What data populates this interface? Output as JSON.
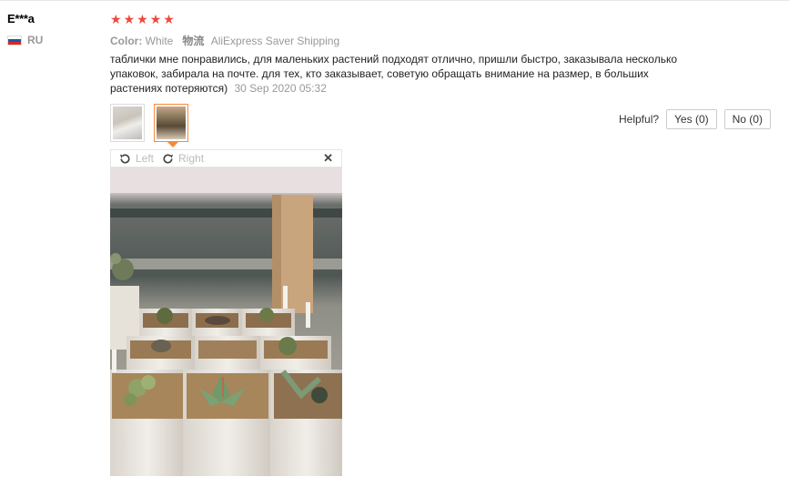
{
  "reviewer": {
    "name": "E***a",
    "country_code": "RU",
    "flag_colors": [
      "#ffffff",
      "#1c57a7",
      "#d52b1e"
    ]
  },
  "rating": {
    "stars": 5,
    "max": 5,
    "color": "#f0483e"
  },
  "attributes": {
    "color_label": "Color:",
    "color_value": "White",
    "shipping_label": "物流",
    "shipping_value": "AliExpress Saver Shipping"
  },
  "review": {
    "text": "таблички мне понравились, для маленьких растений подходят отлично, пришли быстро, заказывала несколько упаковок, забирала на почте. для тех, кто заказывает, советую обращать внимание на размер, в больших растениях потеряются)",
    "date": "30 Sep 2020 05:32"
  },
  "helpful": {
    "label": "Helpful?",
    "yes_label": "Yes (0)",
    "no_label": "No (0)"
  },
  "viewer": {
    "rotate_left_label": "Left",
    "rotate_right_label": "Right",
    "close_symbol": "✕",
    "accent_color": "#f58a3a"
  },
  "icons": {
    "star": "★"
  }
}
